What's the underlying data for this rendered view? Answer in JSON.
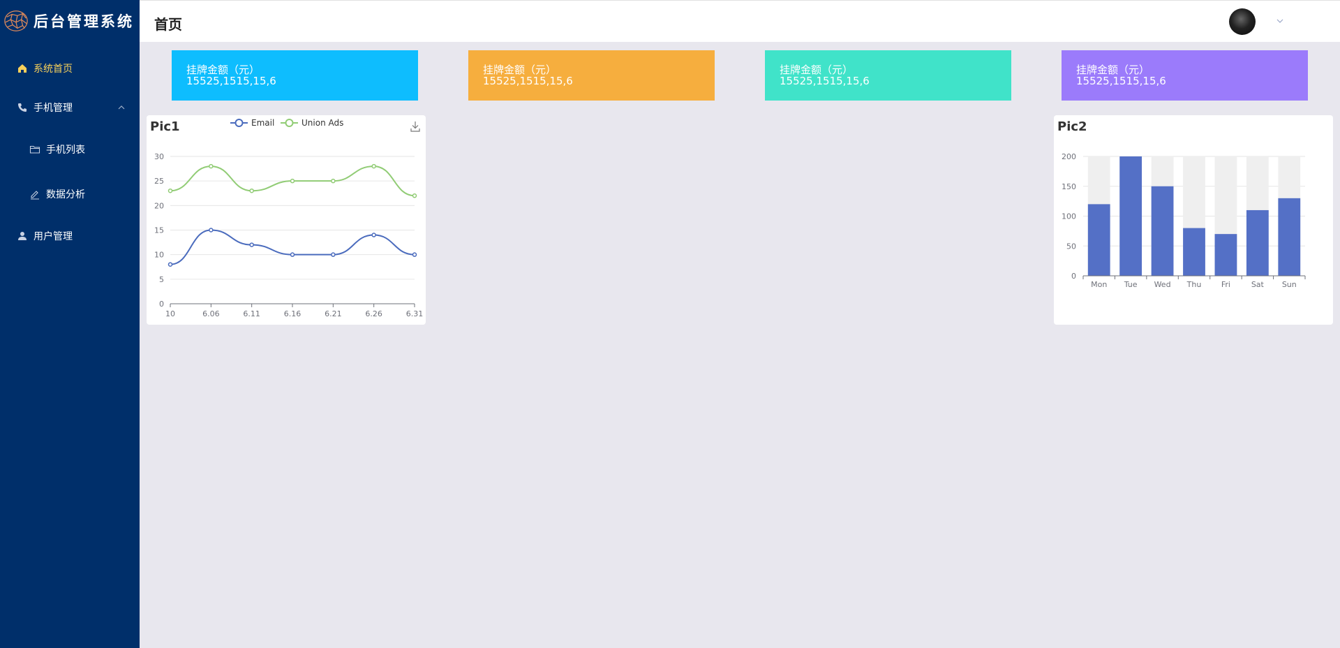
{
  "app": {
    "title": "后台管理系统"
  },
  "sidebar": {
    "items": [
      {
        "label": "系统首页",
        "icon": "home-icon",
        "active": true
      },
      {
        "label": "手机管理",
        "icon": "phone-icon",
        "expanded": true
      },
      {
        "label": "手机列表",
        "icon": "folder-icon",
        "sub": true
      },
      {
        "label": "数据分析",
        "icon": "edit-icon",
        "sub": true
      },
      {
        "label": "用户管理",
        "icon": "user-icon"
      }
    ]
  },
  "header": {
    "title": "首页"
  },
  "cards": [
    {
      "label": "挂牌金额（元）",
      "value": "15525,1515,15,6",
      "color": "#0ebdfe"
    },
    {
      "label": "挂牌金额（元）",
      "value": "15525,1515,15,6",
      "color": "#f6ae3e"
    },
    {
      "label": "挂牌金额（元）",
      "value": "15525,1515,15,6",
      "color": "#40e3c9"
    },
    {
      "label": "挂牌金额（元）",
      "value": "15525,1515,15,6",
      "color": "#9b7bfb"
    }
  ],
  "pic1": {
    "title": "Pic1"
  },
  "pic2": {
    "title": "Pic2"
  },
  "chart_data": [
    {
      "type": "line",
      "title": "Pic1",
      "x": [
        "10",
        "6.06",
        "6.11",
        "6.16",
        "6.21",
        "6.26",
        "6.31"
      ],
      "ylim": [
        0,
        30
      ],
      "yticks": [
        0,
        5,
        10,
        15,
        20,
        25,
        30
      ],
      "smooth": true,
      "legend": "top-center",
      "grid": true,
      "series": [
        {
          "name": "Email",
          "values": [
            8,
            15,
            12,
            10,
            10,
            14,
            10
          ],
          "color": "#4a6bbd"
        },
        {
          "name": "Union Ads",
          "values": [
            23,
            28,
            23,
            25,
            25,
            28,
            22
          ],
          "color": "#91cc75"
        }
      ]
    },
    {
      "type": "bar",
      "title": "Pic2",
      "categories": [
        "Mon",
        "Tue",
        "Wed",
        "Thu",
        "Fri",
        "Sat",
        "Sun"
      ],
      "values": [
        120,
        200,
        150,
        80,
        70,
        110,
        130
      ],
      "ylim": [
        0,
        200
      ],
      "yticks": [
        0,
        50,
        100,
        150,
        200
      ],
      "background_bars": true,
      "color": "#5470c6",
      "grid": true
    }
  ]
}
